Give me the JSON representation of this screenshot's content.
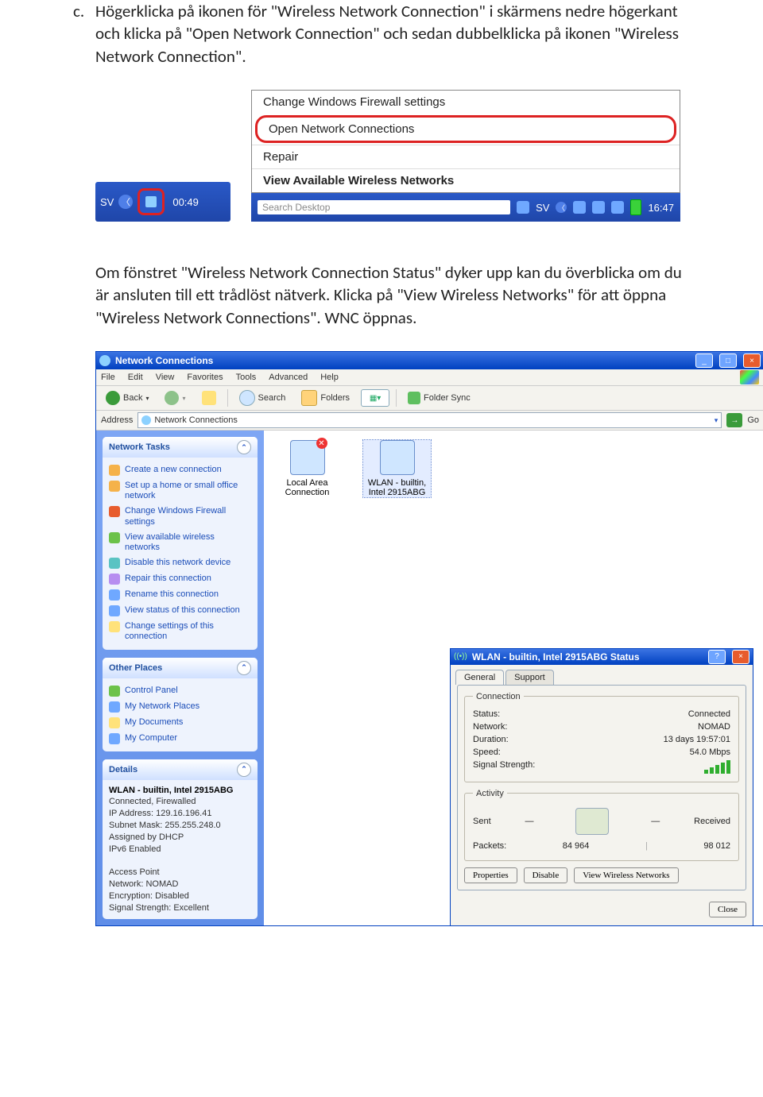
{
  "doc": {
    "list_marker": "c.",
    "para1": "Högerklicka på ikonen för \"Wireless Network Connection\" i skärmens nedre högerkant och klicka på \"Open Network Connection\" och sedan dubbelklicka på ikonen \"Wireless Network Connection\".",
    "para2": "Om fönstret \"Wireless Network Connection Status\" dyker upp kan du överblicka om du är ansluten till ett trådlöst nätverk. Klicka på \"View Wireless Networks\" för att öppna \"Wireless Network Connections\". WNC öppnas."
  },
  "tray_small": {
    "lang": "SV",
    "clock": "00:49"
  },
  "context_menu": {
    "items": [
      "Change Windows Firewall settings",
      "Open Network Connections",
      "Repair",
      "View Available Wireless Networks"
    ]
  },
  "tray_large": {
    "search_placeholder": "Search Desktop",
    "lang": "SV",
    "clock": "16:47"
  },
  "explorer": {
    "title": "Network Connections",
    "menu": [
      "File",
      "Edit",
      "View",
      "Favorites",
      "Tools",
      "Advanced",
      "Help"
    ],
    "toolbar": {
      "back": "Back",
      "search": "Search",
      "folders": "Folders",
      "foldersync": "Folder Sync"
    },
    "address_label": "Address",
    "address_value": "Network Connections",
    "go": "Go",
    "panels": {
      "tasks_title": "Network Tasks",
      "tasks": [
        "Create a new connection",
        "Set up a home or small office network",
        "Change Windows Firewall settings",
        "View available wireless networks",
        "Disable this network device",
        "Repair this connection",
        "Rename this connection",
        "View status of this connection",
        "Change settings of this connection"
      ],
      "places_title": "Other Places",
      "places": [
        "Control Panel",
        "My Network Places",
        "My Documents",
        "My Computer"
      ],
      "details_title": "Details",
      "details": {
        "name": "WLAN - builtin, Intel 2915ABG",
        "state": "Connected, Firewalled",
        "ip_label": "IP Address:",
        "ip": "129.16.196.41",
        "mask_label": "Subnet Mask:",
        "mask": "255.255.248.0",
        "dhcp": "Assigned by DHCP",
        "ipv6": "IPv6 Enabled",
        "ap_label": "Access Point",
        "ap_net_label": "Network:",
        "ap_net": "NOMAD",
        "enc_label": "Encryption:",
        "enc": "Disabled",
        "sig_label": "Signal Strength:",
        "sig": "Excellent"
      }
    },
    "connections": [
      {
        "name": "Local Area Connection",
        "off": true
      },
      {
        "name": "WLAN - builtin, Intel 2915ABG",
        "off": false,
        "selected": true
      }
    ]
  },
  "status_dialog": {
    "title": "WLAN - builtin, Intel 2915ABG Status",
    "tabs": [
      "General",
      "Support"
    ],
    "conn_legend": "Connection",
    "rows": {
      "status_l": "Status:",
      "status_v": "Connected",
      "net_l": "Network:",
      "net_v": "NOMAD",
      "dur_l": "Duration:",
      "dur_v": "13 days 19:57:01",
      "spd_l": "Speed:",
      "spd_v": "54.0 Mbps",
      "sig_l": "Signal Strength:"
    },
    "act_legend": "Activity",
    "sent": "Sent",
    "recv": "Received",
    "pkt_l": "Packets:",
    "pkt_sent": "84 964",
    "pkt_recv": "98 012",
    "buttons": {
      "props": "Properties",
      "disable": "Disable",
      "view": "View Wireless Networks",
      "close": "Close"
    }
  }
}
